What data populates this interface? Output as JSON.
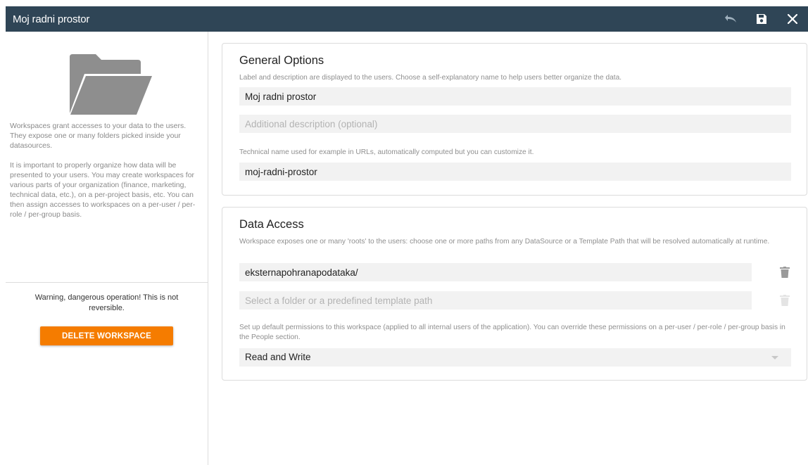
{
  "window": {
    "title": "Moj radni prostor",
    "actions": [
      {
        "name": "undo-icon"
      },
      {
        "name": "save-icon"
      },
      {
        "name": "close-icon"
      }
    ]
  },
  "sidebar": {
    "icon": "folder-icon",
    "paragraph1": "Workspaces grant accesses to your data to the users. They expose one or many folders picked inside your datasources.",
    "paragraph2": "It is important to properly organize how data will be presented to your users. You may create workspaces for various parts of your organization (finance, marketing, technical data, etc.), on a per-project basis, etc. You can then assign accesses to workspaces on a per-user / per-role / per-group basis.",
    "warning": "Warning, dangerous operation! This is not reversible.",
    "delete_label": "DELETE WORKSPACE"
  },
  "general": {
    "title": "General Options",
    "help": "Label and description are displayed to the users. Choose a self-explanatory name to help users better organize the data.",
    "label_value": "Moj radni prostor",
    "description_placeholder": "Additional description (optional)",
    "description_value": "",
    "technical_help": "Technical name used for example in URLs, automatically computed but you can customize it.",
    "technical_value": "moj-radni-prostor"
  },
  "access": {
    "title": "Data Access",
    "help": "Workspace exposes one or many 'roots' to the users: choose one or more paths from any DataSource or a Template Path that will be resolved automatically at runtime.",
    "root_value": "eksternapohranapodataka/",
    "root_placeholder": "Select a folder or a predefined template path",
    "permissions_help": "Set up default permissions to this workspace (applied to all internal users of the application). You can override these permissions on a per-user / per-role / per-group basis in the People section.",
    "permission_value": "Read and Write"
  },
  "colors": {
    "topbar": "#2f4556",
    "accent": "#f57c00",
    "field_bg": "#f2f2f2"
  }
}
